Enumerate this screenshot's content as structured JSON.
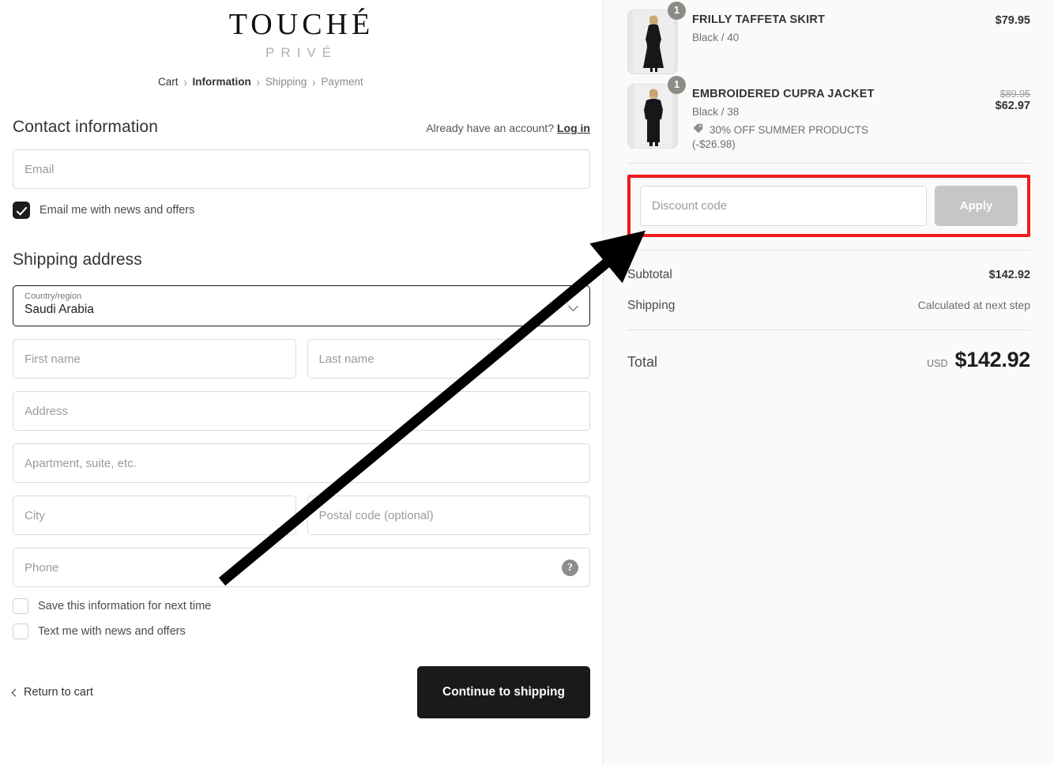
{
  "brand": {
    "name": "TOUCHÉ",
    "tagline": "PRIVÉ"
  },
  "breadcrumb": {
    "items": [
      {
        "label": "Cart",
        "state": "done"
      },
      {
        "label": "Information",
        "state": "active"
      },
      {
        "label": "Shipping",
        "state": "upcoming"
      },
      {
        "label": "Payment",
        "state": "upcoming"
      }
    ],
    "separator": "›"
  },
  "contact": {
    "title": "Contact information",
    "account_prompt": "Already have an account?",
    "login_label": "Log in",
    "email_placeholder": "Email",
    "email_value": "",
    "newsletter_label": "Email me with news and offers",
    "newsletter_checked": true
  },
  "shipping": {
    "title": "Shipping address",
    "country_label": "Country/region",
    "country_value": "Saudi Arabia",
    "first_name_placeholder": "First name",
    "last_name_placeholder": "Last name",
    "address_placeholder": "Address",
    "apartment_placeholder": "Apartment, suite, etc.",
    "city_placeholder": "City",
    "postal_placeholder": "Postal code (optional)",
    "phone_placeholder": "Phone",
    "phone_help_glyph": "?",
    "save_info_label": "Save this information for next time",
    "save_info_checked": false,
    "text_offers_label": "Text me with news and offers",
    "text_offers_checked": false
  },
  "footer": {
    "return_to_cart": "Return to cart",
    "continue_label": "Continue to shipping"
  },
  "summary": {
    "items": [
      {
        "title": "FRILLY TAFFETA SKIRT",
        "variant": "Black / 40",
        "quantity": "1",
        "price": "$79.95",
        "compare_at": "",
        "discount_label": "",
        "discount_amount": ""
      },
      {
        "title": "EMBROIDERED CUPRA JACKET",
        "variant": "Black / 38",
        "quantity": "1",
        "price": "$62.97",
        "compare_at": "$89.95",
        "discount_label": "30% OFF SUMMER PRODUCTS",
        "discount_amount": "(-$26.98)"
      }
    ],
    "discount": {
      "placeholder": "Discount code",
      "value": "",
      "apply_label": "Apply"
    },
    "subtotal_label": "Subtotal",
    "subtotal_value": "$142.92",
    "shipping_label": "Shipping",
    "shipping_value": "Calculated at next step",
    "total_label": "Total",
    "total_currency": "USD",
    "total_value": "$142.92"
  },
  "annotation": {
    "highlight_color": "#ee1c1c",
    "arrow_color": "#000000",
    "target": "discount-code-field"
  }
}
